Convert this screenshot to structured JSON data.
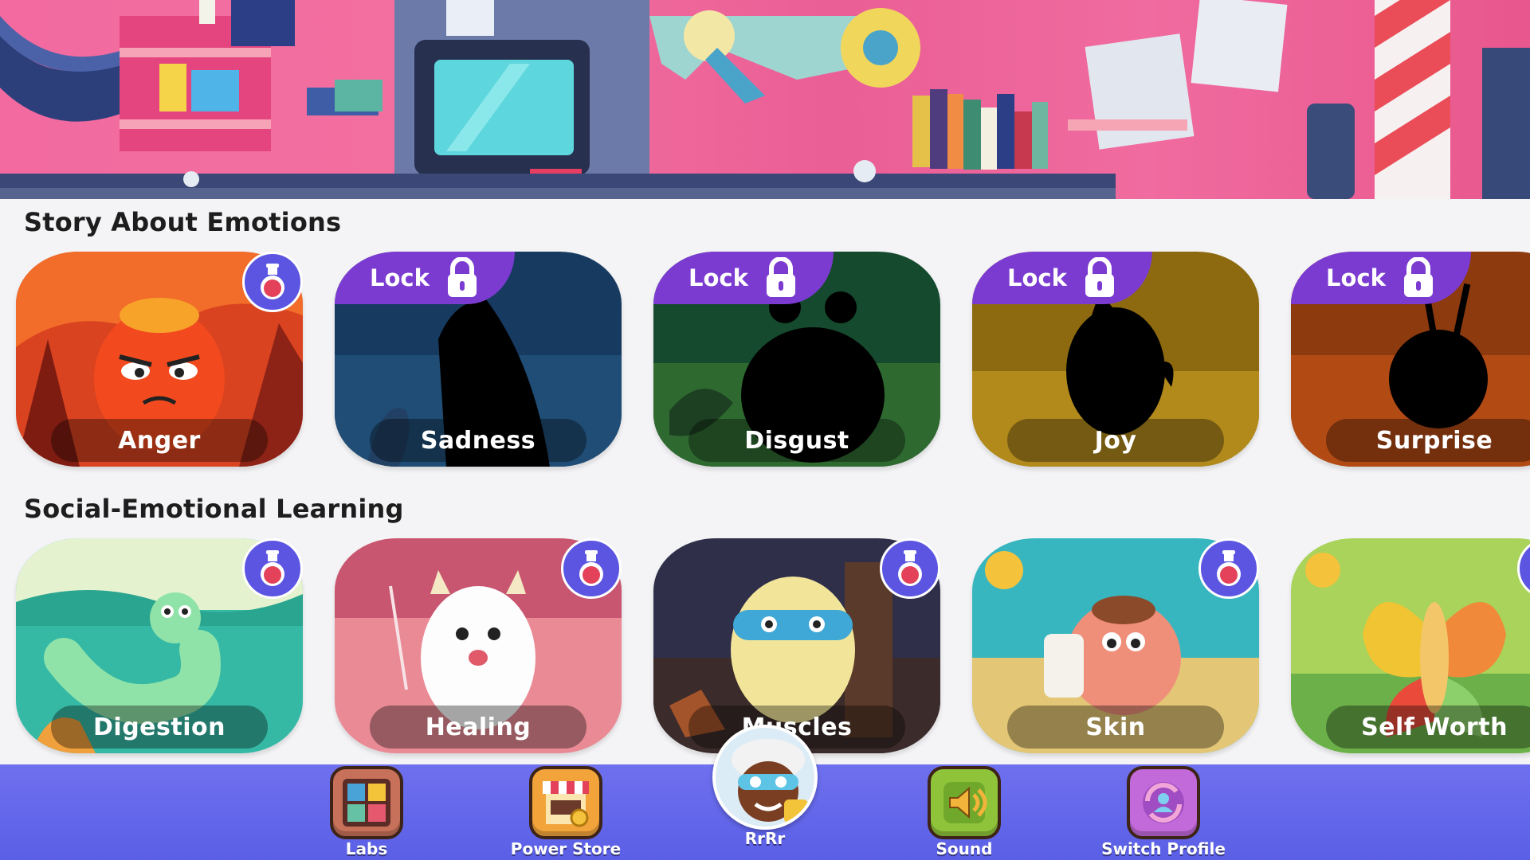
{
  "sections": [
    {
      "title": "Story About Emotions",
      "cards": [
        {
          "label": "Anger",
          "locked": false,
          "badge": "potion-icon"
        },
        {
          "label": "Sadness",
          "locked": true,
          "lock_label": "Lock"
        },
        {
          "label": "Disgust",
          "locked": true,
          "lock_label": "Lock"
        },
        {
          "label": "Joy",
          "locked": true,
          "lock_label": "Lock"
        },
        {
          "label": "Surprise",
          "locked": true,
          "lock_label": "Lock"
        }
      ]
    },
    {
      "title": "Social-Emotional Learning",
      "cards": [
        {
          "label": "Digestion",
          "locked": false,
          "badge": "potion-icon"
        },
        {
          "label": "Healing",
          "locked": false,
          "badge": "potion-icon"
        },
        {
          "label": "Muscles",
          "locked": false,
          "badge": "potion-icon"
        },
        {
          "label": "Skin",
          "locked": false,
          "badge": "potion-icon"
        },
        {
          "label": "Self Worth",
          "locked": false,
          "badge": "potion-icon"
        }
      ]
    }
  ],
  "nav": {
    "labs": "Labs",
    "power_store": "Power Store",
    "profile_name": "RrRr",
    "sound": "Sound",
    "switch_profile": "Switch Profile"
  },
  "colors": {
    "lock_tab": "#7b3bd1",
    "potion_badge": "#5b55e2",
    "bottom_bar": "#6366ea",
    "banner": "#f06b9f"
  }
}
